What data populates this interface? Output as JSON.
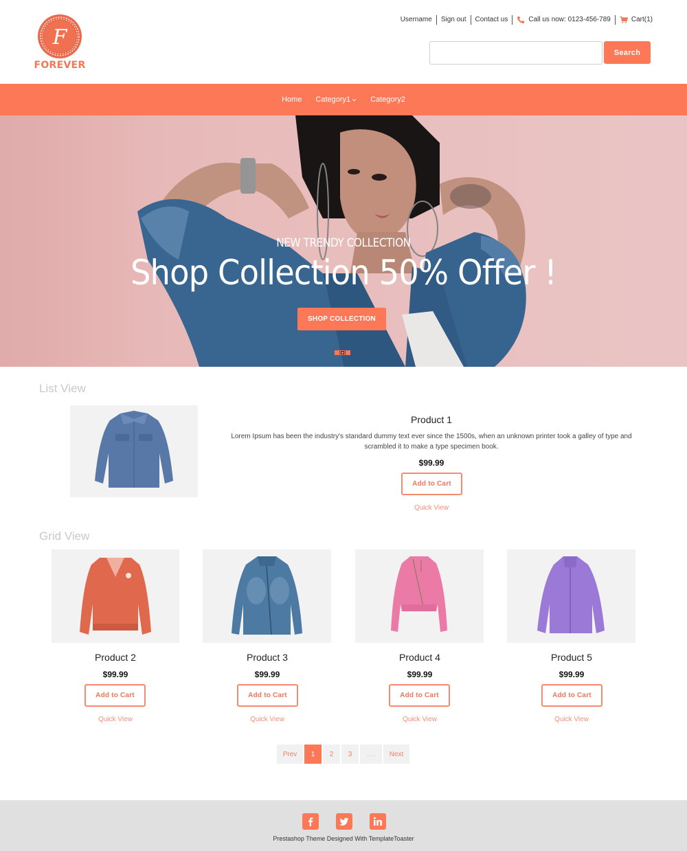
{
  "brand": {
    "name": "FOREVER",
    "monogram": "F",
    "accent_color": "#fd7856"
  },
  "toplinks": {
    "username": "Username",
    "sign_out": "Sign out",
    "contact": "Contact us",
    "phone": "Call us now: 0123-456-789",
    "cart": "Cart(1)"
  },
  "search": {
    "value": "",
    "placeholder": "",
    "button_label": "Search"
  },
  "nav": {
    "items": [
      {
        "label": "Home",
        "has_dropdown": false
      },
      {
        "label": "Category1",
        "has_dropdown": true
      },
      {
        "label": "Category2",
        "has_dropdown": false
      }
    ]
  },
  "hero": {
    "subtitle": "NEW TRENDY COLLECTION",
    "title": "Shop Collection 50% Offer !",
    "button_label": "SHOP COLLECTION",
    "slide_count": 3,
    "active_slide": 2
  },
  "list_view": {
    "title": "List View",
    "product": {
      "name": "Product 1",
      "description": "Lorem Ipsum has been the industry's standard dummy text ever since the 1500s, when an unknown printer took a galley of type and scrambled it to make a type specimen book.",
      "price": "$99.99",
      "add_to_cart": "Add to Cart",
      "quick_view": "Quick View",
      "image": "denim-jacket"
    }
  },
  "grid_view": {
    "title": "Grid View",
    "products": [
      {
        "name": "Product 2",
        "price": "$99.99",
        "add_to_cart": "Add to Cart",
        "quick_view": "Quick View",
        "image": "orange-bomber-jacket"
      },
      {
        "name": "Product 3",
        "price": "$99.99",
        "add_to_cart": "Add to Cart",
        "quick_view": "Quick View",
        "image": "washed-denim-jacket"
      },
      {
        "name": "Product 4",
        "price": "$99.99",
        "add_to_cart": "Add to Cart",
        "quick_view": "Quick View",
        "image": "pink-biker-jacket"
      },
      {
        "name": "Product 5",
        "price": "$99.99",
        "add_to_cart": "Add to Cart",
        "quick_view": "Quick View",
        "image": "purple-fleece-jacket"
      }
    ]
  },
  "pagination": {
    "prev": "Prev",
    "pages": [
      "1",
      "2",
      "3",
      "....."
    ],
    "current": "1",
    "next": "Next"
  },
  "footer": {
    "socials": [
      "facebook",
      "twitter",
      "linkedin"
    ],
    "credit": "Prestashop Theme Designed With TemplateToaster"
  }
}
